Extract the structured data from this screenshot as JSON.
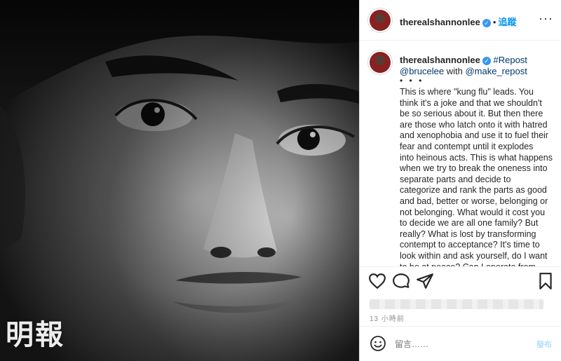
{
  "post": {
    "username": "therealshannonlee",
    "follow_label": "追蹤",
    "more_label": "···",
    "caption_tag": "#Repost",
    "caption_mention_1": "@brucelee",
    "caption_with": "with",
    "caption_mention_2": "@make_repost",
    "caption_ellipsis": "• • •",
    "caption_text": "This is where \"kung flu\" leads. You\nthink it's a joke and that we shouldn't\nbe so serious about it. But then there\nare those who latch onto it with hatred\nand xenophobia and use it to fuel their\nfear and contempt until it explodes\ninto heinous acts. This is what happens\nwhen we try to break the oneness into\nseparate parts and decide to\ncategorize and rank the parts as good\nand bad, better or worse, belonging or\nnot belonging. What would it cost you\nto decide we are all one family? But\nreally? What is lost by transforming\ncontempt to acceptance? It's time to\nlook within and ask yourself, do I want\nto be at peace? Can I operate from",
    "timestamp": "13 小時前",
    "comment_placeholder": "留言……",
    "post_label": "發布"
  },
  "watermark": "明報",
  "icons": [
    "heart-icon",
    "comment-icon",
    "share-icon",
    "bookmark-icon",
    "emoji-icon",
    "verified-icon"
  ],
  "colors": {
    "link": "#00376b",
    "follow": "#0095f6",
    "verified": "#3897f0"
  }
}
